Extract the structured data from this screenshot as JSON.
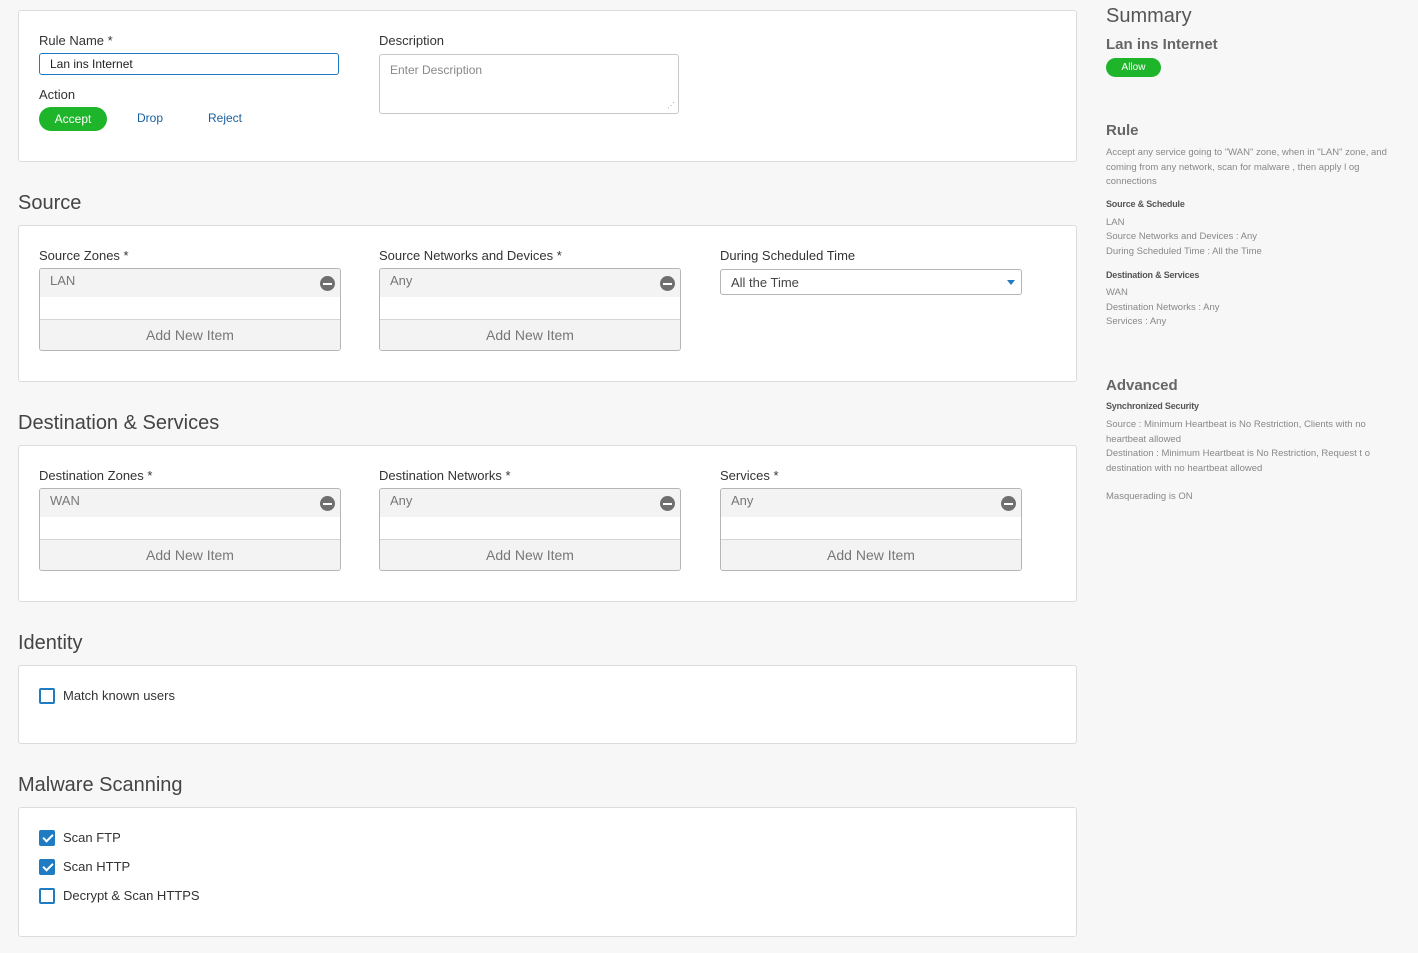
{
  "rule": {
    "name_label": "Rule Name *",
    "name_value": "Lan ins Internet",
    "description_label": "Description",
    "description_placeholder": "Enter Description",
    "action_label": "Action",
    "actions": [
      "Accept",
      "Drop",
      "Reject"
    ],
    "selected_action": "Accept"
  },
  "source": {
    "title": "Source",
    "zones_label": "Source Zones *",
    "zones_items": [
      "LAN"
    ],
    "networks_label": "Source Networks and Devices *",
    "networks_items": [
      "Any"
    ],
    "schedule_label": "During Scheduled Time",
    "schedule_value": "All the Time",
    "add_item_label": "Add New Item"
  },
  "destination": {
    "title": "Destination & Services",
    "zones_label": "Destination Zones *",
    "zones_items": [
      "WAN"
    ],
    "networks_label": "Destination Networks *",
    "networks_items": [
      "Any"
    ],
    "services_label": "Services *",
    "services_items": [
      "Any"
    ],
    "add_item_label": "Add New Item"
  },
  "identity": {
    "title": "Identity",
    "match_known_users": {
      "label": "Match known users",
      "checked": false
    }
  },
  "malware": {
    "title": "Malware Scanning",
    "options": [
      {
        "label": "Scan FTP",
        "checked": true
      },
      {
        "label": "Scan HTTP",
        "checked": true
      },
      {
        "label": "Decrypt & Scan HTTPS",
        "checked": false
      }
    ]
  },
  "summary": {
    "title": "Summary",
    "rule_name": "Lan ins Internet",
    "status_badge": "Allow",
    "rule_heading": "Rule",
    "rule_description": "Accept any service going to \"WAN\" zone, when in \"LAN\" zone, and coming from any network, scan for malware , then apply l og connections",
    "source_schedule_heading": "Source & Schedule",
    "source_zone": "LAN",
    "source_networks": "Source Networks and Devices : Any",
    "scheduled_time": "During Scheduled Time : All the Time",
    "dest_services_heading": "Destination & Services",
    "dest_zone": "WAN",
    "dest_networks": "Destination Networks : Any",
    "services": "Services : Any",
    "advanced_heading": "Advanced",
    "sync_security_heading": "Synchronized Security",
    "sync_source": "Source : Minimum Heartbeat is No Restriction, Clients with no heartbeat allowed",
    "sync_destination": "Destination : Minimum Heartbeat is No Restriction, Request t o destination with no heartbeat allowed",
    "masquerading": "Masquerading is ON"
  },
  "colors": {
    "accent_green": "#1eb52b",
    "accent_blue": "#1f7bc2",
    "link_blue": "#1a5fa0"
  }
}
